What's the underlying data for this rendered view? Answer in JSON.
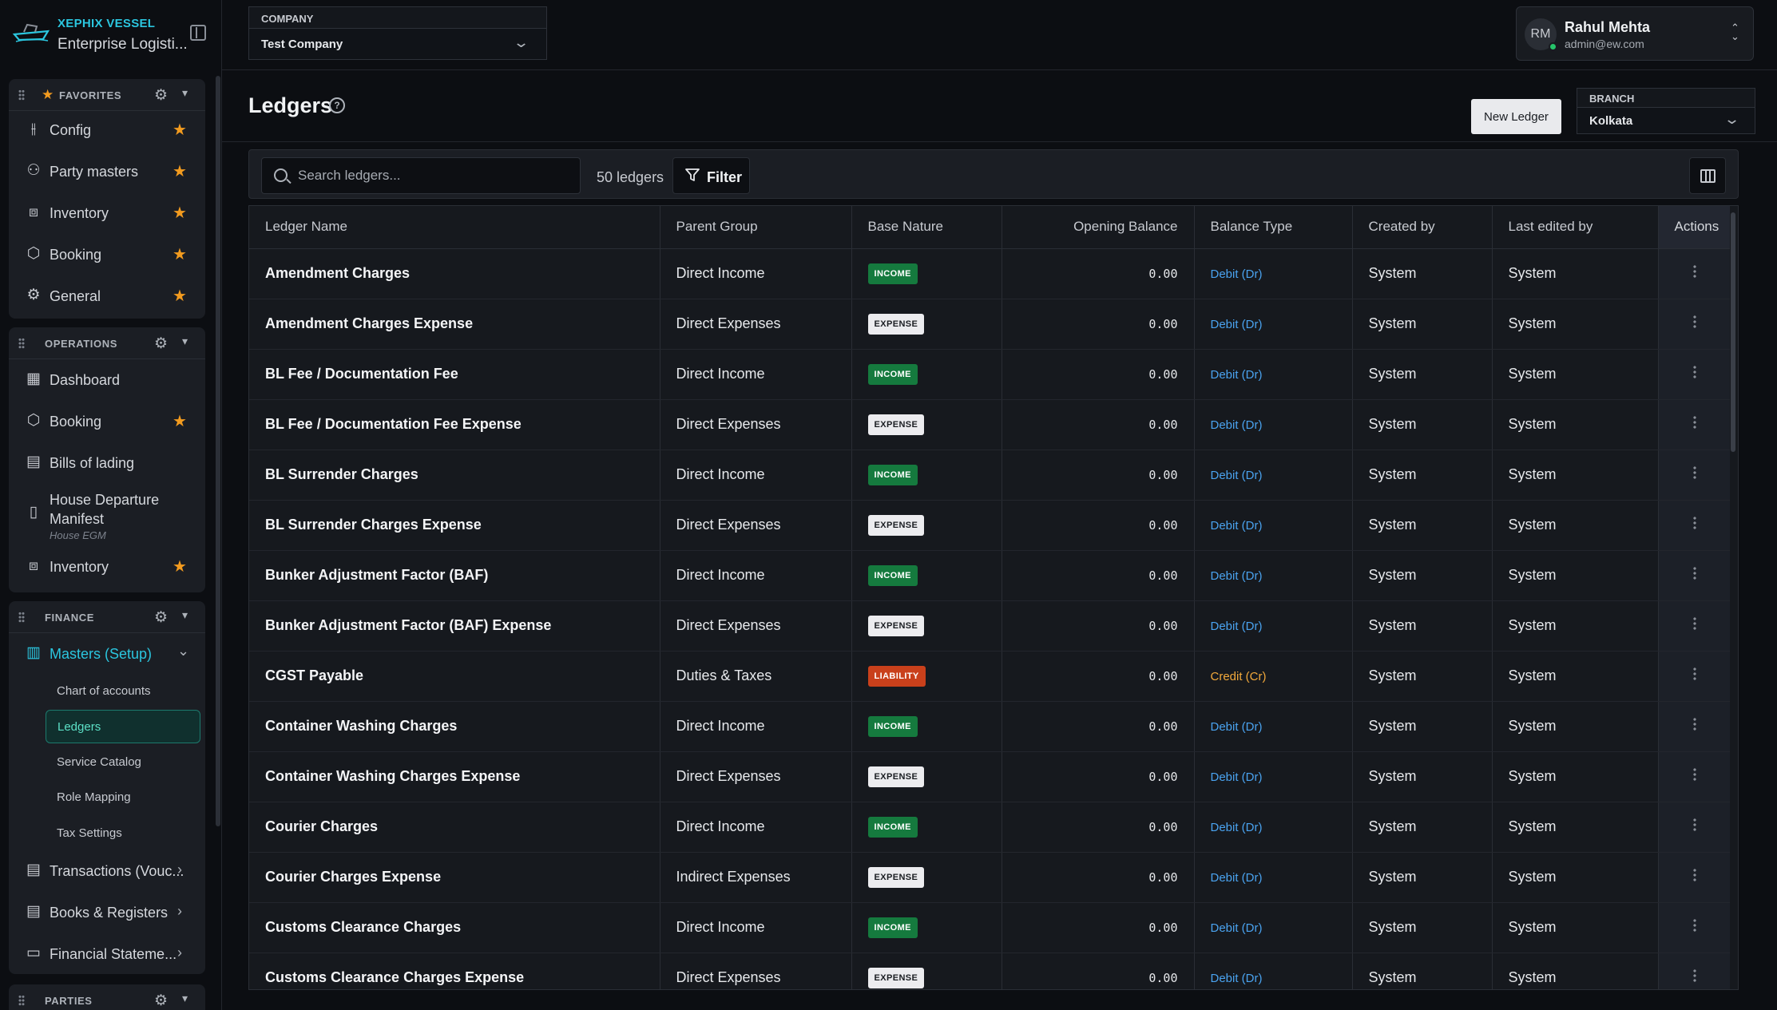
{
  "brand": {
    "title": "XEPHIX VESSEL",
    "subtitle": "Enterprise Logisti..."
  },
  "sidebar": {
    "favorites": {
      "title": "FAVORITES",
      "items": [
        {
          "label": "Config",
          "icon": "sliders-icon"
        },
        {
          "label": "Party masters",
          "icon": "users-icon"
        },
        {
          "label": "Inventory",
          "icon": "boxes-icon"
        },
        {
          "label": "Booking",
          "icon": "package-icon"
        },
        {
          "label": "General",
          "icon": "gear-icon"
        }
      ]
    },
    "operations": {
      "title": "OPERATIONS",
      "items": [
        {
          "label": "Dashboard",
          "icon": "dashboard-icon"
        },
        {
          "label": "Booking",
          "icon": "package-icon"
        },
        {
          "label": "Bills of lading",
          "icon": "scroll-icon"
        },
        {
          "label": "House Departure Manifest",
          "sublabel": "House EGM",
          "icon": "document-icon"
        },
        {
          "label": "Inventory",
          "icon": "boxes-icon"
        }
      ]
    },
    "finance": {
      "title": "FINANCE",
      "masters": {
        "label": "Masters (Setup)"
      },
      "sub_items": [
        "Chart of accounts",
        "Ledgers",
        "Service Catalog",
        "Role Mapping",
        "Tax Settings"
      ],
      "items": [
        {
          "label": "Transactions (Vouc..."
        },
        {
          "label": "Books & Registers"
        },
        {
          "label": "Financial Stateme..."
        }
      ]
    },
    "parties": {
      "title": "PARTIES"
    }
  },
  "topbar": {
    "company_label": "COMPANY",
    "company_value": "Test Company",
    "user": {
      "initials": "RM",
      "name": "Rahul Mehta",
      "email": "admin@ew.com"
    }
  },
  "page": {
    "title": "Ledgers",
    "new_button": "New Ledger",
    "branch_label": "BRANCH",
    "branch_value": "Kolkata"
  },
  "toolbar": {
    "search_placeholder": "Search ledgers...",
    "count": "50 ledgers",
    "filter_label": "Filter"
  },
  "table": {
    "columns": [
      "Ledger Name",
      "Parent Group",
      "Base Nature",
      "Opening Balance",
      "Balance Type",
      "Created by",
      "Last edited by",
      "Actions"
    ],
    "rows": [
      {
        "name": "Amendment Charges",
        "group": "Direct Income",
        "nature": "INCOME",
        "balance": "0.00",
        "type": "Debit (Dr)",
        "created": "System",
        "edited": "System"
      },
      {
        "name": "Amendment Charges Expense",
        "group": "Direct Expenses",
        "nature": "EXPENSE",
        "balance": "0.00",
        "type": "Debit (Dr)",
        "created": "System",
        "edited": "System"
      },
      {
        "name": "BL Fee / Documentation Fee",
        "group": "Direct Income",
        "nature": "INCOME",
        "balance": "0.00",
        "type": "Debit (Dr)",
        "created": "System",
        "edited": "System"
      },
      {
        "name": "BL Fee / Documentation Fee Expense",
        "group": "Direct Expenses",
        "nature": "EXPENSE",
        "balance": "0.00",
        "type": "Debit (Dr)",
        "created": "System",
        "edited": "System"
      },
      {
        "name": "BL Surrender Charges",
        "group": "Direct Income",
        "nature": "INCOME",
        "balance": "0.00",
        "type": "Debit (Dr)",
        "created": "System",
        "edited": "System"
      },
      {
        "name": "BL Surrender Charges Expense",
        "group": "Direct Expenses",
        "nature": "EXPENSE",
        "balance": "0.00",
        "type": "Debit (Dr)",
        "created": "System",
        "edited": "System"
      },
      {
        "name": "Bunker Adjustment Factor (BAF)",
        "group": "Direct Income",
        "nature": "INCOME",
        "balance": "0.00",
        "type": "Debit (Dr)",
        "created": "System",
        "edited": "System"
      },
      {
        "name": "Bunker Adjustment Factor (BAF) Expense",
        "group": "Direct Expenses",
        "nature": "EXPENSE",
        "balance": "0.00",
        "type": "Debit (Dr)",
        "created": "System",
        "edited": "System"
      },
      {
        "name": "CGST Payable",
        "group": "Duties & Taxes",
        "nature": "LIABILITY",
        "balance": "0.00",
        "type": "Credit (Cr)",
        "created": "System",
        "edited": "System"
      },
      {
        "name": "Container Washing Charges",
        "group": "Direct Income",
        "nature": "INCOME",
        "balance": "0.00",
        "type": "Debit (Dr)",
        "created": "System",
        "edited": "System"
      },
      {
        "name": "Container Washing Charges Expense",
        "group": "Direct Expenses",
        "nature": "EXPENSE",
        "balance": "0.00",
        "type": "Debit (Dr)",
        "created": "System",
        "edited": "System"
      },
      {
        "name": "Courier Charges",
        "group": "Direct Income",
        "nature": "INCOME",
        "balance": "0.00",
        "type": "Debit (Dr)",
        "created": "System",
        "edited": "System"
      },
      {
        "name": "Courier Charges Expense",
        "group": "Indirect Expenses",
        "nature": "EXPENSE",
        "balance": "0.00",
        "type": "Debit (Dr)",
        "created": "System",
        "edited": "System"
      },
      {
        "name": "Customs Clearance Charges",
        "group": "Direct Income",
        "nature": "INCOME",
        "balance": "0.00",
        "type": "Debit (Dr)",
        "created": "System",
        "edited": "System"
      },
      {
        "name": "Customs Clearance Charges Expense",
        "group": "Direct Expenses",
        "nature": "EXPENSE",
        "balance": "0.00",
        "type": "Debit (Dr)",
        "created": "System",
        "edited": "System"
      }
    ]
  },
  "colors": {
    "accent": "#2bc6df",
    "income": "#157a3e",
    "expense": "#ececef",
    "liability": "#c9401b",
    "debit": "#4aa3f0",
    "credit": "#f2a93b",
    "favorite_star": "#f29b1f"
  }
}
